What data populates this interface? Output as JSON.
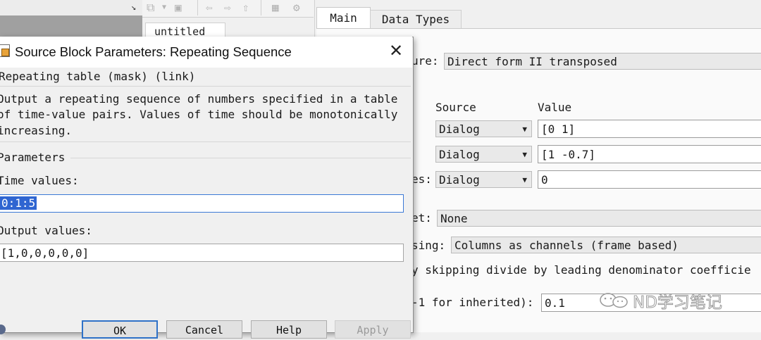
{
  "background_window": {
    "toolbar_icons": [
      "new-model-icon",
      "save-icon",
      "back-icon",
      "forward-icon",
      "up-icon",
      "grid-icon",
      "gear-icon"
    ],
    "model_tab": "untitled",
    "small_arrow": "↘"
  },
  "filter_dialog": {
    "tabs": [
      {
        "label": "Main",
        "active": true
      },
      {
        "label": "Data Types",
        "active": false
      }
    ],
    "structure_label": "ure:",
    "structure_value": "Direct form II transposed",
    "col_source": "Source",
    "col_value": "Value",
    "rows": [
      {
        "label": "",
        "source": "Dialog",
        "value": "[0 1]"
      },
      {
        "label": "",
        "source": "Dialog",
        "value": "[1 -0.7]"
      },
      {
        "label": "es:",
        "source": "Dialog",
        "value": "0"
      }
    ],
    "reset_label": "et:",
    "reset_value": "None",
    "processing_label": "sing:",
    "processing_value": "Columns as channels (frame based)",
    "checkbox_text": "y skipping divide by leading denominator coefficie",
    "sample_time_label": "-1 for inherited):",
    "sample_time_value": "0.1"
  },
  "source_dialog": {
    "title": "Source Block Parameters: Repeating Sequence",
    "block_type": "Repeating table (mask) (link)",
    "description_lines": [
      "Output a repeating sequence of numbers specified in a table",
      "of time-value pairs. Values of time should be monotonically",
      "increasing."
    ],
    "parameters_label": "Parameters",
    "time_label": "Time values:",
    "time_value": "0:1:5",
    "output_label": "Output values:",
    "output_value": "[1,0,0,0,0,0]",
    "buttons": {
      "ok": "OK",
      "cancel": "Cancel",
      "help": "Help",
      "apply": "Apply"
    }
  },
  "watermark": "ND学习笔记",
  "colors": {
    "selection": "#2f65d1",
    "ok_border": "#2f72c8",
    "focus_border": "#3b79d6"
  }
}
